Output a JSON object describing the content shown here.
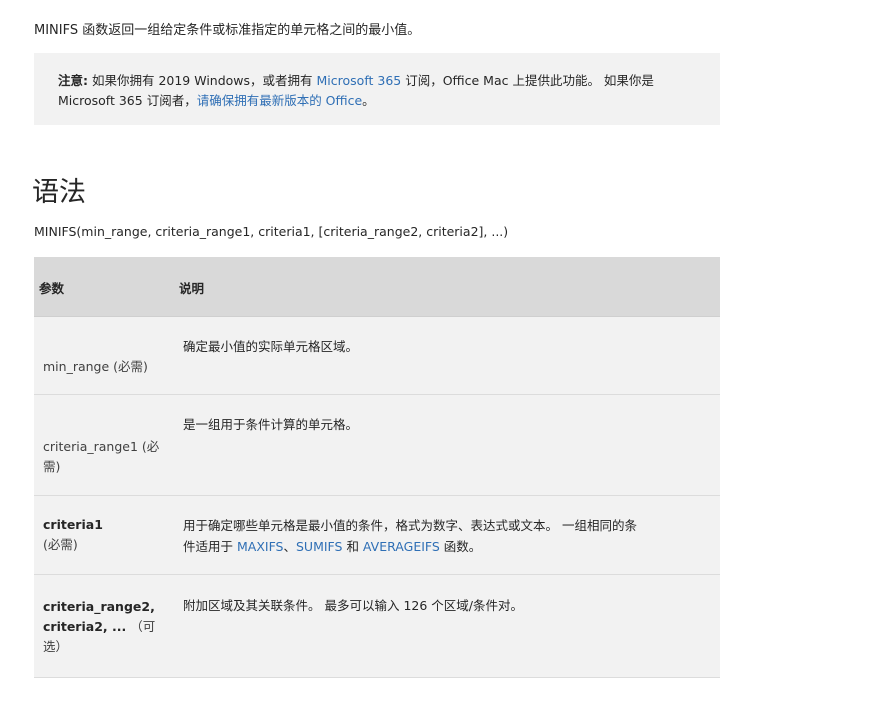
{
  "intro": "MINIFS 函数返回一组给定条件或标准指定的单元格之间的最小值。",
  "note": {
    "label": "注意:",
    "text_1": " 如果你拥有 2019 Windows，或者拥有 ",
    "link_m365": "Microsoft 365",
    "text_2": " 订阅，Office Mac 上提供此功能。 如果你是",
    "text_3": "Microsoft 365 订阅者，",
    "link_update": "请确保拥有最新版本的 Office",
    "text_4": "。"
  },
  "heading": "语法",
  "syntax": "MINIFS(min_range, criteria_range1, criteria1, [criteria_range2, criteria2], ...)",
  "table": {
    "header_param": "参数",
    "header_desc": "说明",
    "rows": [
      {
        "param": "min_range (必需)",
        "desc": "确定最小值的实际单元格区域。"
      },
      {
        "param_a": "criteria_range1 (必",
        "param_b": "需)",
        "desc": "是一组用于条件计算的单元格。"
      },
      {
        "param_bold": "criteria1",
        "param_rest": "(必需)",
        "desc_1": "用于确定哪些单元格是最小值的条件，格式为数字、表达式或文本。 一组相同的条",
        "desc_2": "件适用于 ",
        "link_maxifs": "MAXIFS",
        "sep_1": "、",
        "link_sumifs": "SUMIFS",
        "sep_2": " 和 ",
        "link_averageifs": "AVERAGEIFS",
        "desc_3": " 函数。"
      },
      {
        "param_bold_1": "criteria_range2,",
        "param_bold_2": "criteria2",
        "param_bold_3": ", ...",
        "param_rest_1": " （可",
        "param_rest_2": "选）",
        "desc": "附加区域及其关联条件。 最多可以输入 126 个区域/条件对。"
      }
    ]
  },
  "colors": {
    "link": "#2f6fb5",
    "note_bg": "#f2f2f2",
    "header_bg": "#d9d9d9"
  }
}
